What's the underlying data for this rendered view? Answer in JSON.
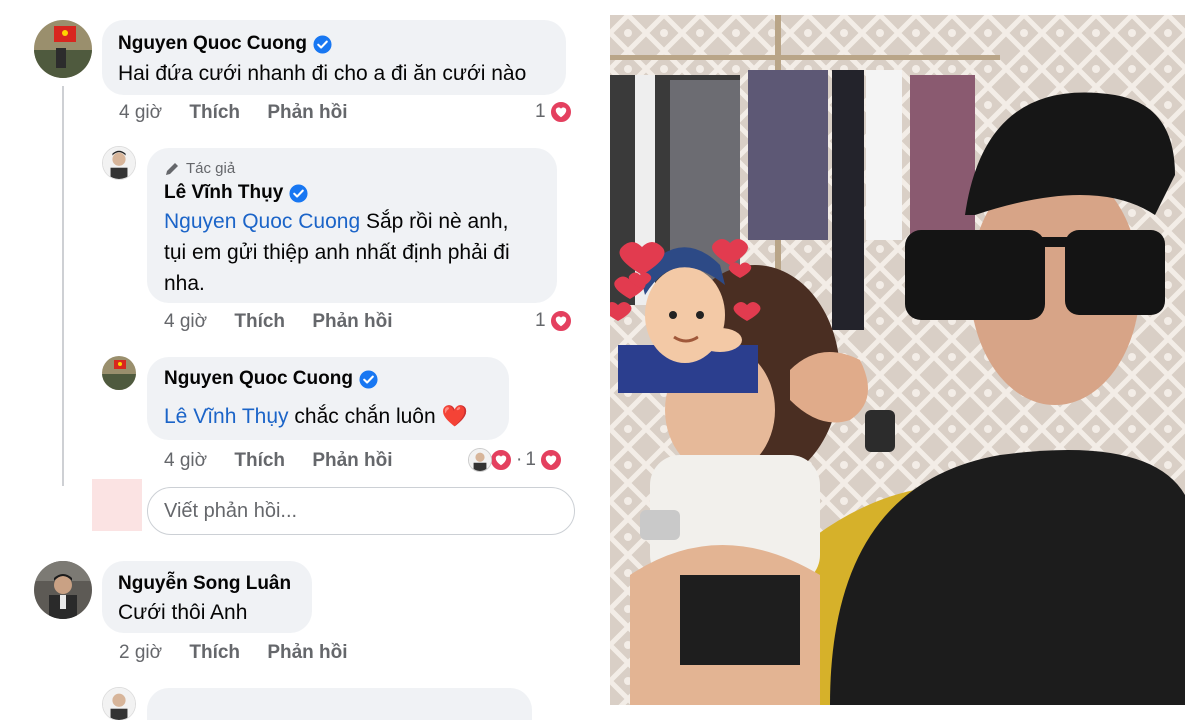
{
  "comments": [
    {
      "author": "Nguyen Quoc Cuong",
      "verified": true,
      "text": "Hai đứa cưới nhanh đi cho a đi ăn cưới nào",
      "time": "4 giờ",
      "like_label": "Thích",
      "reply_label": "Phản hồi",
      "reaction_count": "1"
    },
    {
      "author_tag": "Tác giả",
      "author": "Lê Vĩnh Thụy",
      "verified": true,
      "mention": "Nguyen Quoc Cuong",
      "text_line1": "Sắp rồi nè anh,",
      "text_line2": "tụi em gửi thiệp anh nhất định phải đi",
      "text_line3": "nha.",
      "time": "4 giờ",
      "like_label": "Thích",
      "reply_label": "Phản hồi",
      "reaction_count": "1"
    },
    {
      "author": "Nguyen Quoc Cuong",
      "verified": true,
      "mention": "Lê Vĩnh Thụy",
      "text": "chắc chắn luôn",
      "emoji": "❤️",
      "time": "4 giờ",
      "like_label": "Thích",
      "reply_label": "Phản hồi",
      "reaction_prefix": "·",
      "reaction_count": "1"
    },
    {
      "author": "Nguyễn Song Luân",
      "verified": false,
      "text": "Cưới thôi Anh",
      "time": "2 giờ",
      "like_label": "Thích",
      "reply_label": "Phản hồi"
    }
  ],
  "reply_box": {
    "placeholder": "Viết phản hồi..."
  },
  "colors": {
    "bubble": "#f0f2f5",
    "mention": "#1b64c8",
    "verified": "#1877f2",
    "heart": "#e4405f",
    "meta": "#65676b"
  },
  "photo": {
    "icons": [
      "heart-sticker",
      "man-emoji-sticker",
      "sunglasses"
    ]
  }
}
